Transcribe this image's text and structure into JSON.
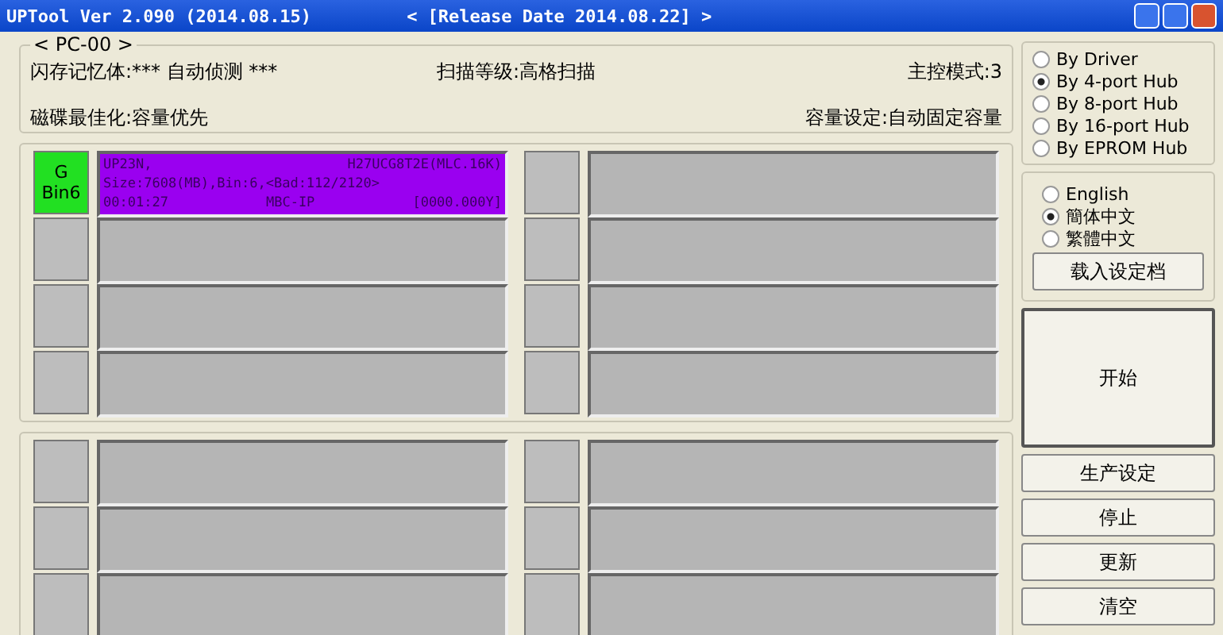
{
  "window": {
    "title": "UPTool Ver 2.090 (2014.08.15)",
    "subtitle": "< [Release Date 2014.08.22] >"
  },
  "info_panel": {
    "legend": "< PC-00 >",
    "rows": [
      {
        "left": "闪存记忆体:*** 自动侦测 ***",
        "center": "扫描等级:高格扫描",
        "right": "主控模式:3"
      },
      {
        "left": "磁碟最佳化:容量优先",
        "right": "容量设定:自动固定容量"
      }
    ]
  },
  "mode_options": [
    {
      "label": "By Driver",
      "selected": false
    },
    {
      "label": "By 4-port Hub",
      "selected": true
    },
    {
      "label": "By 8-port Hub",
      "selected": false
    },
    {
      "label": "By 16-port Hub",
      "selected": false
    },
    {
      "label": "By EPROM Hub",
      "selected": false
    }
  ],
  "language_options": [
    {
      "label": "English",
      "selected": false
    },
    {
      "label": "簡体中文",
      "selected": true
    },
    {
      "label": "繁體中文",
      "selected": false
    }
  ],
  "load_button": "载入设定档",
  "start_button": "开始",
  "buttons": [
    "生产设定",
    "停止",
    "更新",
    "清空"
  ],
  "groups": [
    {
      "columns": [
        [
          {
            "kind": "active",
            "status": "G",
            "bin": "Bin6",
            "color": "#22e022",
            "lines": [
              [
                "UP23N,",
                "H27UCG8T2E(MLC.16K)"
              ],
              [
                "Size:7608(MB),Bin:6,<Bad:112/2120>"
              ],
              [
                "00:01:27",
                "MBC-IP",
                "[0000.000Y]"
              ]
            ]
          },
          {
            "kind": "empty"
          },
          {
            "kind": "empty"
          },
          {
            "kind": "empty"
          }
        ],
        [
          {
            "kind": "empty"
          },
          {
            "kind": "empty"
          },
          {
            "kind": "empty"
          },
          {
            "kind": "empty"
          }
        ]
      ]
    },
    {
      "columns": [
        [
          {
            "kind": "empty"
          },
          {
            "kind": "empty"
          },
          {
            "kind": "empty"
          }
        ],
        [
          {
            "kind": "empty"
          },
          {
            "kind": "empty"
          },
          {
            "kind": "empty"
          }
        ]
      ]
    }
  ]
}
